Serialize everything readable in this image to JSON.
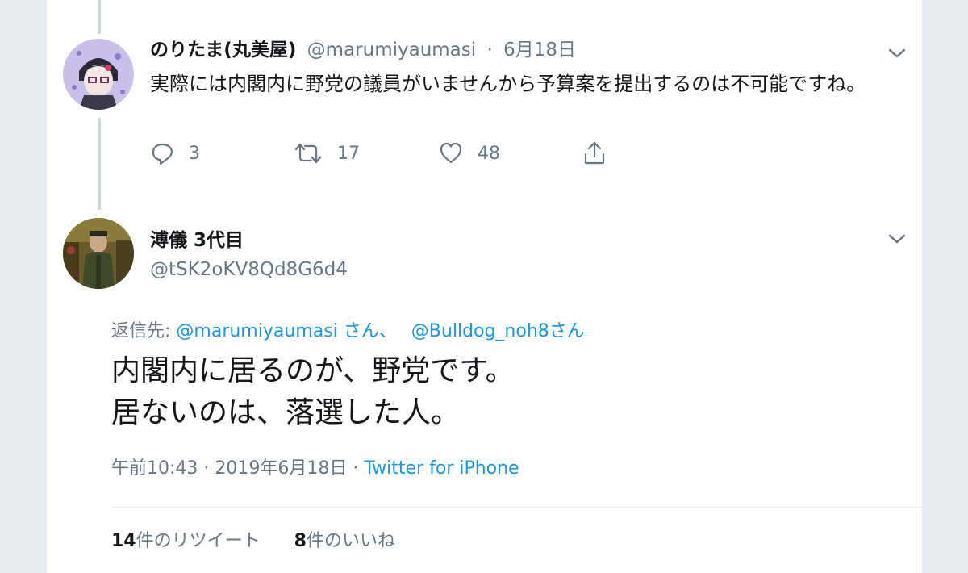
{
  "colors": {
    "link": "#1b95e0",
    "muted": "#657786",
    "text": "#14171a",
    "thread_line": "#ccd6dd",
    "background": "#e6ecf0"
  },
  "parent_tweet": {
    "display_name": "のりたま(丸美屋)",
    "handle": "@marumiyaumasi",
    "separator": "·",
    "date": "6月18日",
    "text": "実際には内閣内に野党の議員がいませんから予算案を提出するのは不可能ですね。",
    "actions": {
      "reply": {
        "icon": "reply-icon",
        "count": "3"
      },
      "retweet": {
        "icon": "retweet-icon",
        "count": "17"
      },
      "like": {
        "icon": "heart-icon",
        "count": "48"
      },
      "share": {
        "icon": "share-icon"
      }
    }
  },
  "main_tweet": {
    "display_name": "溥儀 3代目",
    "handle": "@tSK2oKV8Qd8G6d4",
    "reply_to": {
      "prefix": "返信先: ",
      "user1": "@marumiyaumasi",
      "suffix1": " さん、",
      "user2": "@Bulldog_noh8",
      "suffix2": "さん"
    },
    "text_line1": "内閣内に居るのが、野党です。",
    "text_line2": "居ないのは、落選した人。",
    "meta": {
      "time": "午前10:43",
      "sep1": " · ",
      "date": "2019年6月18日",
      "sep2": " · ",
      "source": "Twitter for iPhone"
    },
    "stats": {
      "retweets_count": "14",
      "retweets_label": "件のリツイート",
      "likes_count": "8",
      "likes_label": "件のいいね"
    }
  }
}
